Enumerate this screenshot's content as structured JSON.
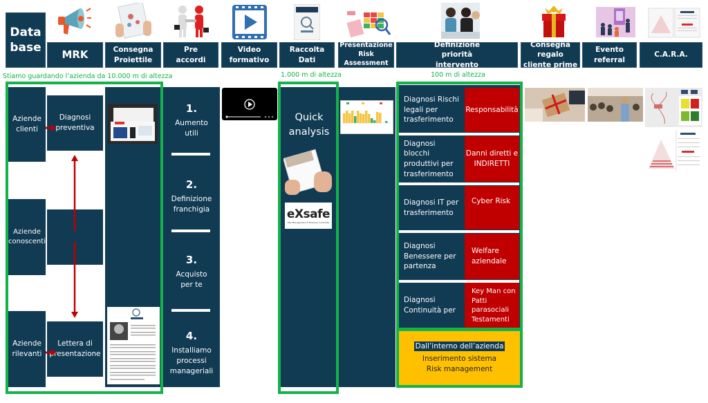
{
  "header": {
    "database": "Data base",
    "columns": [
      {
        "label": "MRK",
        "icon": "megaphone-icon"
      },
      {
        "label": "Consegna Proiettile",
        "icon": "brochure-icon"
      },
      {
        "label": "Pre accordi",
        "icon": "handshake-icon"
      },
      {
        "label": "Video formativo",
        "icon": "video-play-icon"
      },
      {
        "label": "Raccolta Dati",
        "icon": "report-icon"
      },
      {
        "label": "Presentazione Risk Assessment",
        "icon": "risk-matrix-icon"
      },
      {
        "label": "Definizione priorità intervento",
        "icon": "meeting-icon"
      },
      {
        "label": "Consegna regalo cliente prime",
        "icon": "gift-icon"
      },
      {
        "label": "Evento referral",
        "icon": "event-icon"
      },
      {
        "label": "C.A.R.A.",
        "icon": "document-icon"
      }
    ]
  },
  "altitude_labels": {
    "high": "Stiamo guardando l’azienda da 10.000 m di altezza",
    "mid": "1.000 m di altezza",
    "low": "100 m di altezza"
  },
  "database_section": {
    "segments": [
      "Aziende clienti",
      "Aziende conoscenti",
      "Aziende rilevanti"
    ],
    "actions": [
      "Diagnosi preventiva",
      "",
      "Lettera di presentazione"
    ]
  },
  "pre_accordi_steps": [
    {
      "num": "1.",
      "label": "Aumento utili"
    },
    {
      "num": "2.",
      "label": "Definizione franchigia"
    },
    {
      "num": "3.",
      "label": "Acquisto per te"
    },
    {
      "num": "4.",
      "label": "Installiamo processi manageriali"
    }
  ],
  "raccolta_dati": {
    "title": "Quick analysis",
    "logo_text": "eXsafe",
    "logo_sub": "Risk Management & Business Continuity"
  },
  "priorities": [
    {
      "diagnosis": "Diagnosi Rischi legali per trasferimento",
      "risk": "Responsabilità"
    },
    {
      "diagnosis": "Diagnosi blocchi produttivi per trasferimento",
      "risk": "Danni diretti e INDIRETTI"
    },
    {
      "diagnosis": "Diagnosi IT per trasferimento",
      "risk": "Cyber Risk"
    },
    {
      "diagnosis": "Diagnosi Benessere per partenza",
      "risk": "Welfare aziendale"
    },
    {
      "diagnosis": "Diagnosi Continuità per",
      "risk": "Key Man con Patti parasociali Testamenti"
    }
  ],
  "internal_box": {
    "title": "Dall’interno dell’azienda",
    "line1": "Inserimento sistema",
    "line2": "Risk management"
  },
  "colors": {
    "navy": "#113a53",
    "green": "#14b24a",
    "red": "#c00000",
    "yellow": "#ffc000"
  }
}
